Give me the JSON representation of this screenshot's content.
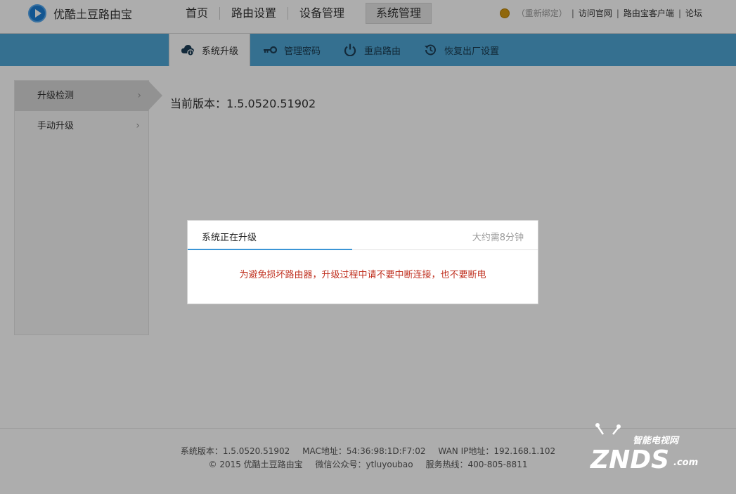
{
  "header": {
    "brand": "优酷土豆路由宝",
    "nav": [
      {
        "label": "首页"
      },
      {
        "label": "路由设置"
      },
      {
        "label": "设备管理"
      },
      {
        "label": "系统管理"
      }
    ],
    "rebind": "（重新绑定）",
    "links": [
      "访问官网",
      "路由宝客户端",
      "论坛"
    ]
  },
  "subnav": {
    "items": [
      {
        "label": "系统升级",
        "icon": "cloud-upgrade-icon"
      },
      {
        "label": "管理密码",
        "icon": "key-icon"
      },
      {
        "label": "重启路由",
        "icon": "power-icon"
      },
      {
        "label": "恢复出厂设置",
        "icon": "restore-icon"
      }
    ]
  },
  "sidebar": {
    "items": [
      {
        "label": "升级检测"
      },
      {
        "label": "手动升级"
      }
    ]
  },
  "main": {
    "current_version": "当前版本：1.5.0520.51902"
  },
  "modal": {
    "title": "系统正在升级",
    "time": "大约需8分钟",
    "progress": 0.47,
    "message": "为避免损坏路由器，升级过程中请不要中断连接，也不要断电"
  },
  "footer": {
    "version": "系统版本：1.5.0520.51902",
    "mac": "MAC地址：54:36:98:1D:F7:02",
    "wan": "WAN IP地址：192.168.1.102",
    "copyright": "© 2015 优酷土豆路由宝",
    "wechat": "微信公众号：ytluyoubao",
    "hotline": "服务热线：400-805-8811"
  },
  "watermark": {
    "top": "智能电视网",
    "main": "ZNDS",
    "suffix": ".com"
  },
  "colors": {
    "subnav": "#4fa6d4",
    "accent": "#3b95d6",
    "warning_text": "#c0301f"
  }
}
